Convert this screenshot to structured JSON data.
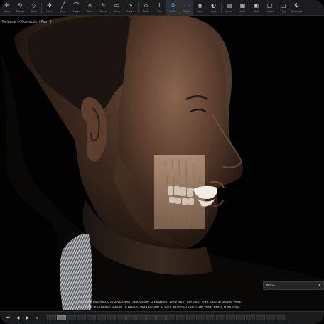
{
  "toolbar": {
    "items": [
      {
        "icon": "move-icon",
        "glyph": "✛",
        "label": "Move"
      },
      {
        "icon": "rotate-icon",
        "glyph": "↻",
        "label": "Rotate"
      },
      {
        "icon": "node-icon",
        "glyph": "◇",
        "label": "Node"
      },
      {
        "icon": "pan-icon",
        "glyph": "✥",
        "label": "Pan"
      },
      {
        "icon": "line-icon",
        "glyph": "╱",
        "label": "Line"
      },
      {
        "icon": "curve-icon",
        "glyph": "⌒",
        "label": "Curve"
      },
      {
        "icon": "arch-icon",
        "glyph": "∩",
        "label": "Arch"
      },
      {
        "icon": "draw-icon",
        "glyph": "✎",
        "label": "Draw"
      },
      {
        "icon": "ruler-icon",
        "glyph": "▭",
        "label": "Ruler"
      },
      {
        "icon": "curve2-icon",
        "glyph": "∿",
        "label": "Curve"
      },
      {
        "icon": "tooth-icon",
        "glyph": "⍝",
        "label": "Tooth"
      },
      {
        "icon": "cut-icon",
        "glyph": "⌇",
        "label": "Cut"
      },
      {
        "icon": "teeth-icon",
        "glyph": "♁",
        "label": "Teeth"
      },
      {
        "icon": "smile-icon",
        "glyph": "◠",
        "label": "Smile"
      },
      {
        "icon": "face-icon",
        "glyph": "◉",
        "label": "Face"
      },
      {
        "icon": "soft-tissue-icon",
        "glyph": "◐",
        "label": "Soft"
      },
      {
        "icon": "layers-icon",
        "glyph": "▤",
        "label": "Layer"
      },
      {
        "icon": "grid-icon",
        "glyph": "▦",
        "label": "Grid"
      },
      {
        "icon": "snapshot-icon",
        "glyph": "▣",
        "label": "Shot"
      },
      {
        "icon": "export-icon",
        "glyph": "▢",
        "label": "Export"
      },
      {
        "icon": "view-icon",
        "glyph": "◫",
        "label": "View"
      },
      {
        "icon": "settings-icon",
        "glyph": "⚙",
        "label": "Settings"
      }
    ]
  },
  "breadcrumb": "Release > Correction Plan 2",
  "dropdown": {
    "value": "None"
  },
  "caption": {
    "line1": "Cephalometric analysis with soft tissue simulation, view from the right side, lateral profile view.",
    "line2": "Use left mouse button to rotate, right button to pan, wheel to zoom the view; press H for help."
  },
  "bottombar": {
    "controls": [
      {
        "icon": "skip-back-icon",
        "glyph": "⏮"
      },
      {
        "icon": "step-back-icon",
        "glyph": "◀"
      },
      {
        "icon": "play-icon",
        "glyph": "▶"
      },
      {
        "icon": "step-forward-icon",
        "glyph": "▸"
      }
    ],
    "frames": 24,
    "active_frame": 1
  },
  "colors": {
    "toolbar_bg": "#1b1c1e",
    "active_icon": "#3fa2ff",
    "viewport_bg": "#020202"
  }
}
